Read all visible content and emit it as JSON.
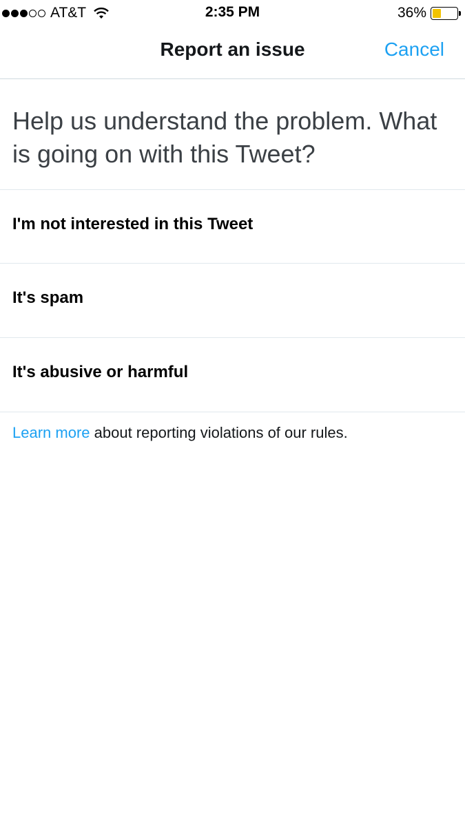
{
  "status_bar": {
    "carrier": "AT&T",
    "signal_bars_filled": 3,
    "signal_bars_total": 5,
    "time": "2:35 PM",
    "battery_percent": "36%",
    "battery_level": 0.36,
    "battery_color": "#f2c300",
    "wifi_icon": "wifi-icon"
  },
  "nav": {
    "title": "Report an issue",
    "cancel_label": "Cancel",
    "accent_color": "#1da1f2"
  },
  "prompt": {
    "text": "Help us understand the problem. What is going on with this Tweet?"
  },
  "options": [
    {
      "label": "I'm not interested in this Tweet"
    },
    {
      "label": "It's spam"
    },
    {
      "label": "It's abusive or harmful"
    }
  ],
  "footer": {
    "link_text": "Learn more",
    "text": " about reporting violations of our rules."
  }
}
